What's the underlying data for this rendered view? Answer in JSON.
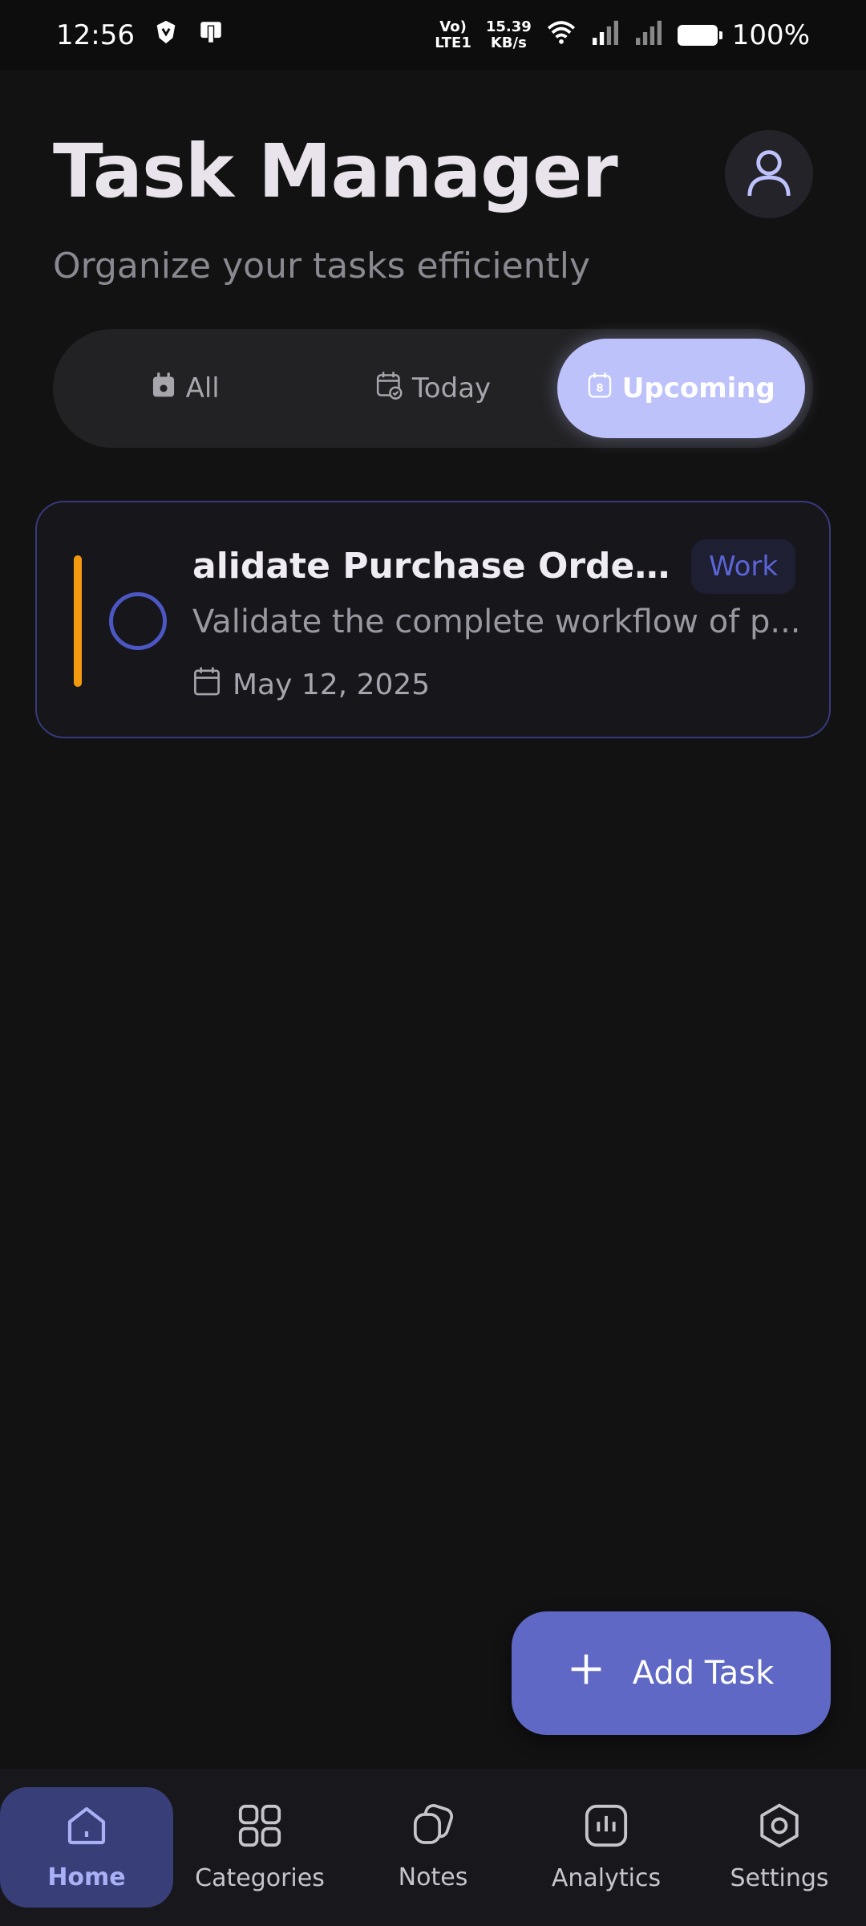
{
  "status_bar": {
    "time": "12:56",
    "network_label_top": "Vo)",
    "network_label_bottom": "LTE1",
    "speed_top": "15.39",
    "speed_bottom": "KB/s",
    "battery": "100%"
  },
  "header": {
    "title": "Task Manager",
    "subtitle": "Organize your tasks efficiently"
  },
  "tabs": [
    {
      "label": "All",
      "icon": "calendar-filled-icon",
      "active": false
    },
    {
      "label": "Today",
      "icon": "calendar-check-icon",
      "active": false
    },
    {
      "label": "Upcoming",
      "icon": "calendar-date-icon",
      "active": true
    }
  ],
  "upcoming_icon_number": "8",
  "tasks": [
    {
      "title": "alidate Purchase Order W...",
      "category": "Work",
      "description": "Validate the complete workflow of p...",
      "date": "May 12, 2025",
      "priority_color": "#f29a10"
    }
  ],
  "fab": {
    "label": "Add Task",
    "icon": "plus-icon"
  },
  "bottom_nav": [
    {
      "label": "Home",
      "icon": "home-icon",
      "active": true
    },
    {
      "label": "Categories",
      "icon": "grid-icon",
      "active": false
    },
    {
      "label": "Notes",
      "icon": "notes-icon",
      "active": false
    },
    {
      "label": "Analytics",
      "icon": "analytics-icon",
      "active": false
    },
    {
      "label": "Settings",
      "icon": "settings-icon",
      "active": false
    }
  ],
  "colors": {
    "accent": "#bec2fb",
    "primary": "#5f68c4",
    "background": "#121212",
    "card_border": "#363a7a",
    "category_text": "#5a66d6",
    "nav_active_bg": "#383e77"
  }
}
